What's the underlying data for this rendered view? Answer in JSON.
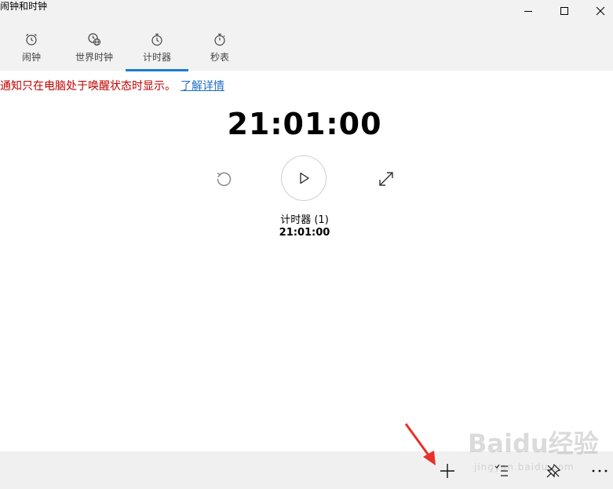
{
  "app": {
    "title": "闹钟和时钟"
  },
  "tabs": [
    {
      "label": "闹钟",
      "icon": "alarm-clock-icon"
    },
    {
      "label": "世界时钟",
      "icon": "world-clock-icon"
    },
    {
      "label": "计时器",
      "icon": "timer-icon",
      "active": true
    },
    {
      "label": "秒表",
      "icon": "stopwatch-icon"
    }
  ],
  "notice": {
    "text": "通知只在电脑处于唤醒状态时显示。",
    "link": "了解详情"
  },
  "timer": {
    "display": "21:01:00",
    "name": "计时器 (1)",
    "small_display": "21:01:00"
  },
  "watermark": {
    "text": "Baidu经验",
    "sub": "jingyan.baidu.com"
  },
  "colors": {
    "accent": "#1e7bd0",
    "notice": "#c00000",
    "link": "#1e6fc8",
    "arrow": "#e8302a"
  }
}
